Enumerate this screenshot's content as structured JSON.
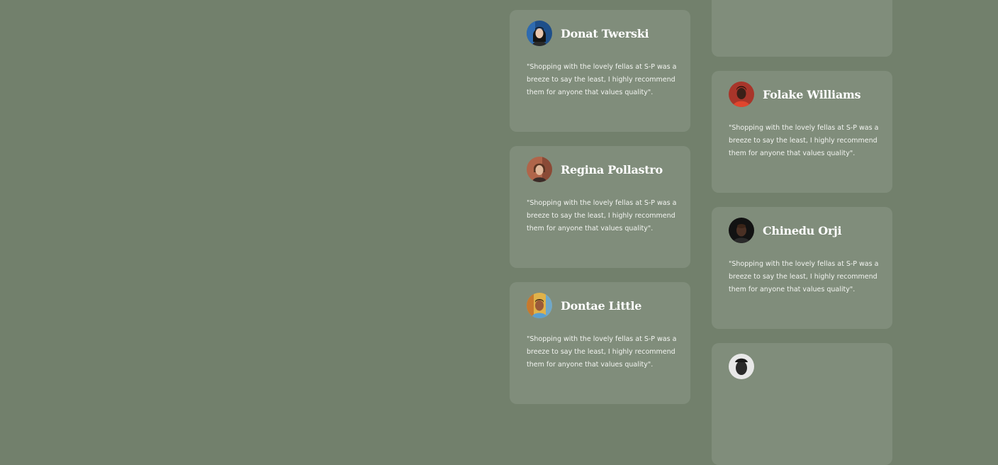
{
  "testimonials": [
    {
      "name": "Donat Twerski",
      "quote": "\"Shopping with the lovely fellas at S-P was a breeze to say the least, I highly recommend them for anyone that values quality\"."
    },
    {
      "name": "Regina Pollastro",
      "quote": "\"Shopping with the lovely fellas at S-P was a breeze to say the least, I highly recommend them for anyone that values quality\"."
    },
    {
      "name": "Dontae Little",
      "quote": "\"Shopping with the lovely fellas at S-P was a breeze to say the least, I highly recommend them for anyone that values quality\"."
    },
    {
      "name": "Folake Williams",
      "quote": "\"Shopping with the lovely fellas at S-P was a breeze to say the least, I highly recommend them for anyone that values quality\"."
    },
    {
      "name": "Chinedu Orji",
      "quote": "\"Shopping with the lovely fellas at S-P was a breeze to say the least, I highly recommend them for anyone that values quality\"."
    }
  ],
  "colors": {
    "page_background": "#72806c",
    "card_background": "#808d7b",
    "text": "#ffffff"
  }
}
